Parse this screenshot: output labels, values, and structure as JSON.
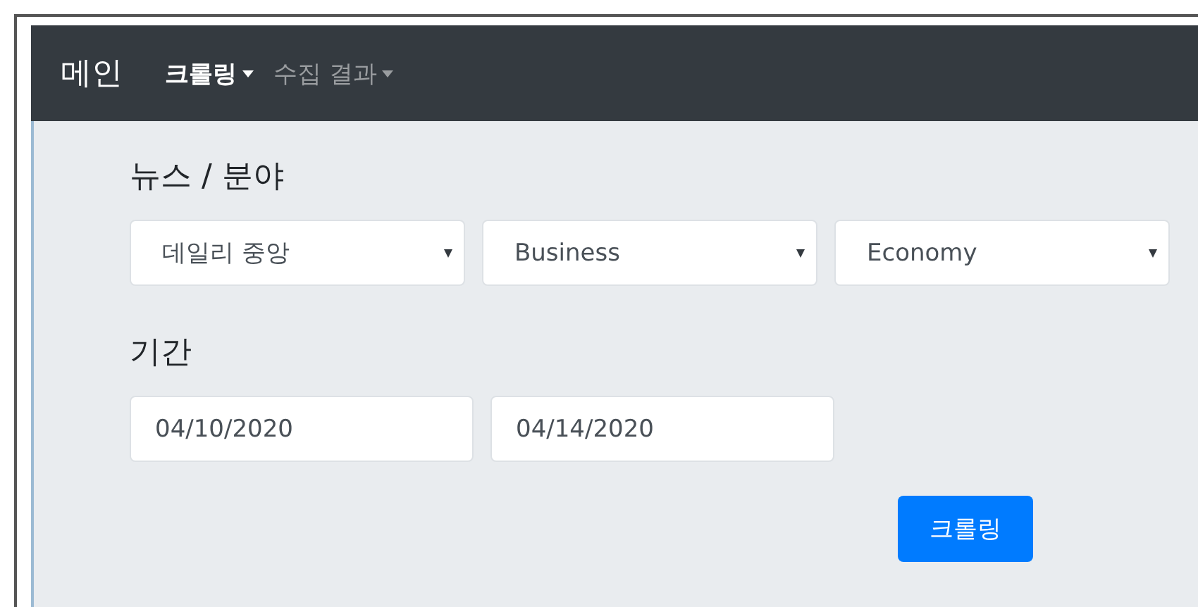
{
  "navbar": {
    "brand": "메인",
    "items": [
      {
        "label": "크롤링",
        "selected": true
      },
      {
        "label": "수집 결과",
        "selected": false
      }
    ]
  },
  "news_section": {
    "heading": "뉴스 / 분야",
    "selects": [
      {
        "value": "데일리 중앙"
      },
      {
        "value": "Business"
      },
      {
        "value": "Economy"
      }
    ]
  },
  "period_section": {
    "heading": "기간",
    "dates": [
      {
        "value": "04/10/2020"
      },
      {
        "value": "04/14/2020"
      }
    ]
  },
  "submit_button": "크롤링"
}
